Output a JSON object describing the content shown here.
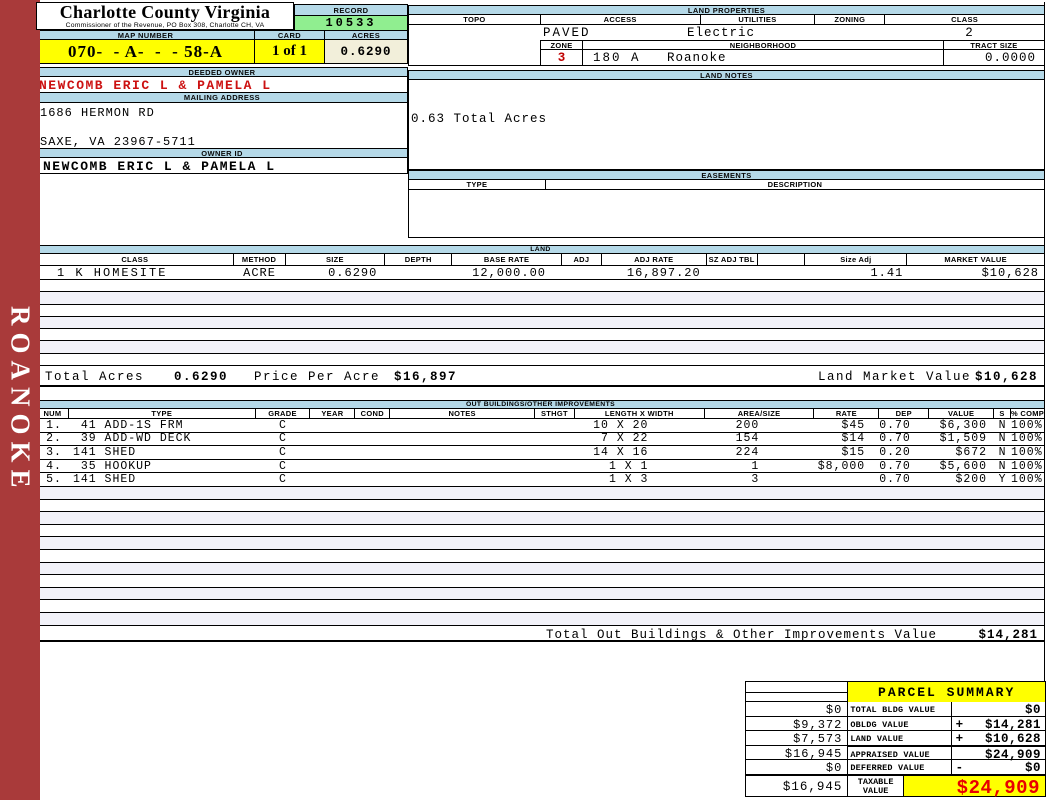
{
  "county": {
    "title": "Charlotte County Virginia",
    "subtitle": "Commissioner of the Revenue, PO Box 308, Charlotte CH, VA"
  },
  "sidebar": {
    "district": "ROANOKE"
  },
  "record": {
    "label": "RECORD",
    "value": "10533"
  },
  "map": {
    "map_number_label": "MAP NUMBER",
    "map_number": "070-  - A-  -  - 58-A",
    "card_label": "CARD",
    "card": "1 of 1",
    "acres_label": "ACRES",
    "acres": "0.6290"
  },
  "owner": {
    "deeded_owner_label": "DEEDED OWNER",
    "deeded_owner": "NEWCOMB ERIC L & PAMELA L",
    "mailing_address_label": "MAILING ADDRESS",
    "address_line1": "1686 HERMON RD",
    "address_line2": "SAXE, VA 23967-5711",
    "owner_id_label": "OWNER ID",
    "owner_id": "NEWCOMB ERIC L & PAMELA L"
  },
  "land_properties": {
    "title": "LAND PROPERTIES",
    "headers": {
      "topo": "TOPO",
      "access": "ACCESS",
      "utilities": "UTILITIES",
      "zoning": "ZONING",
      "class": "CLASS"
    },
    "values": {
      "topo": "",
      "access": "PAVED",
      "utilities": "Electric",
      "zoning": "",
      "class": "2"
    },
    "zone_row": {
      "zone_label": "ZONE",
      "zone": "3",
      "neighborhood_label": "NEIGHBORHOOD",
      "neighborhood_code": "180 A",
      "neighborhood_name": "Roanoke",
      "tract_size_label": "TRACT SIZE",
      "tract_size": "0.0000"
    }
  },
  "land_notes": {
    "title": "LAND NOTES",
    "note": "0.63 Total Acres"
  },
  "easements": {
    "title": "EASEMENTS",
    "type_label": "TYPE",
    "description_label": "DESCRIPTION"
  },
  "land": {
    "title": "LAND",
    "headers": [
      "CLASS",
      "METHOD",
      "SIZE",
      "DEPTH",
      "BASE RATE",
      "ADJ",
      "ADJ RATE",
      "SZ ADJ TBL",
      "",
      "Size Adj",
      "MARKET VALUE"
    ],
    "rows": [
      {
        "class": "1 K HOMESITE",
        "method": "ACRE",
        "size": "0.6290",
        "depth": "",
        "base_rate": "12,000.00",
        "adj": "",
        "adj_rate": "16,897.20",
        "sz_adj_tbl": "",
        "size_adj": "1.41",
        "market_value": "$10,628"
      }
    ],
    "totals": {
      "total_acres_label": "Total Acres",
      "total_acres": "0.6290",
      "price_per_acre_label": "Price Per Acre",
      "price_per_acre": "$16,897",
      "land_market_value_label": "Land Market Value",
      "land_market_value": "$10,628"
    }
  },
  "out_buildings": {
    "title": "OUT BUILDINGS/OTHER IMPROVEMENTS",
    "headers": [
      "NUM",
      "TYPE",
      "GRADE",
      "YEAR",
      "COND",
      "NOTES",
      "STHGT",
      "LENGTH X WIDTH",
      "AREA/SIZE",
      "RATE",
      "DEP",
      "VALUE",
      "S",
      "% COMP"
    ],
    "rows": [
      {
        "num": "1.",
        "type": " 41 ADD-1S FRM",
        "grade": "C",
        "year": "",
        "cond": "",
        "notes": "",
        "sthgt": "",
        "lw": "10 X 20",
        "area": "200",
        "rate": "$45",
        "dep": "0.70",
        "value": "$6,300",
        "s": "N",
        "comp": "100%"
      },
      {
        "num": "2.",
        "type": " 39 ADD-WD DECK",
        "grade": "C",
        "year": "",
        "cond": "",
        "notes": "",
        "sthgt": "",
        "lw": "7 X 22",
        "area": "154",
        "rate": "$14",
        "dep": "0.70",
        "value": "$1,509",
        "s": "N",
        "comp": "100%"
      },
      {
        "num": "3.",
        "type": "141 SHED",
        "grade": "C",
        "year": "",
        "cond": "",
        "notes": "",
        "sthgt": "",
        "lw": "14 X 16",
        "area": "224",
        "rate": "$15",
        "dep": "0.20",
        "value": "$672",
        "s": "N",
        "comp": "100%"
      },
      {
        "num": "4.",
        "type": " 35 HOOKUP",
        "grade": "C",
        "year": "",
        "cond": "",
        "notes": "",
        "sthgt": "",
        "lw": "1 X 1",
        "area": "1",
        "rate": "$8,000",
        "dep": "0.70",
        "value": "$5,600",
        "s": "N",
        "comp": "100%"
      },
      {
        "num": "5.",
        "type": "141 SHED",
        "grade": "C",
        "year": "",
        "cond": "",
        "notes": "",
        "sthgt": "",
        "lw": "1 X 3",
        "area": "3",
        "rate": "",
        "dep": "0.70",
        "value": "$200",
        "s": "Y",
        "comp": "100%"
      }
    ],
    "total_label": "Total Out Buildings & Other Improvements Value",
    "total_value": "$14,281"
  },
  "parcel_summary": {
    "title": "PARCEL SUMMARY",
    "rows": [
      {
        "prior": "$0",
        "label": "TOTAL BLDG VALUE",
        "op": "",
        "value": "$0"
      },
      {
        "prior": "$9,372",
        "label": "OBLDG VALUE",
        "op": "+",
        "value": "$14,281"
      },
      {
        "prior": "$7,573",
        "label": "LAND VALUE",
        "op": "+",
        "value": "$10,628"
      },
      {
        "prior": "$16,945",
        "label": "APPRAISED VALUE",
        "op": "",
        "value": "$24,909"
      },
      {
        "prior": "$0",
        "label": "DEFERRED VALUE",
        "op": "-",
        "value": "$0"
      }
    ],
    "taxable": {
      "prior": "$16,945",
      "label": "TAXABLE VALUE",
      "value": "$24,909"
    }
  },
  "colors": {
    "header_blue": "#B5D9E8",
    "highlight_yellow": "#FFFF00",
    "record_green": "#90EE90",
    "acres_cream": "#F2EFDA",
    "sidebar_red": "#A93A3A",
    "owner_red": "#CC1111",
    "taxable_red": "#E80000"
  }
}
